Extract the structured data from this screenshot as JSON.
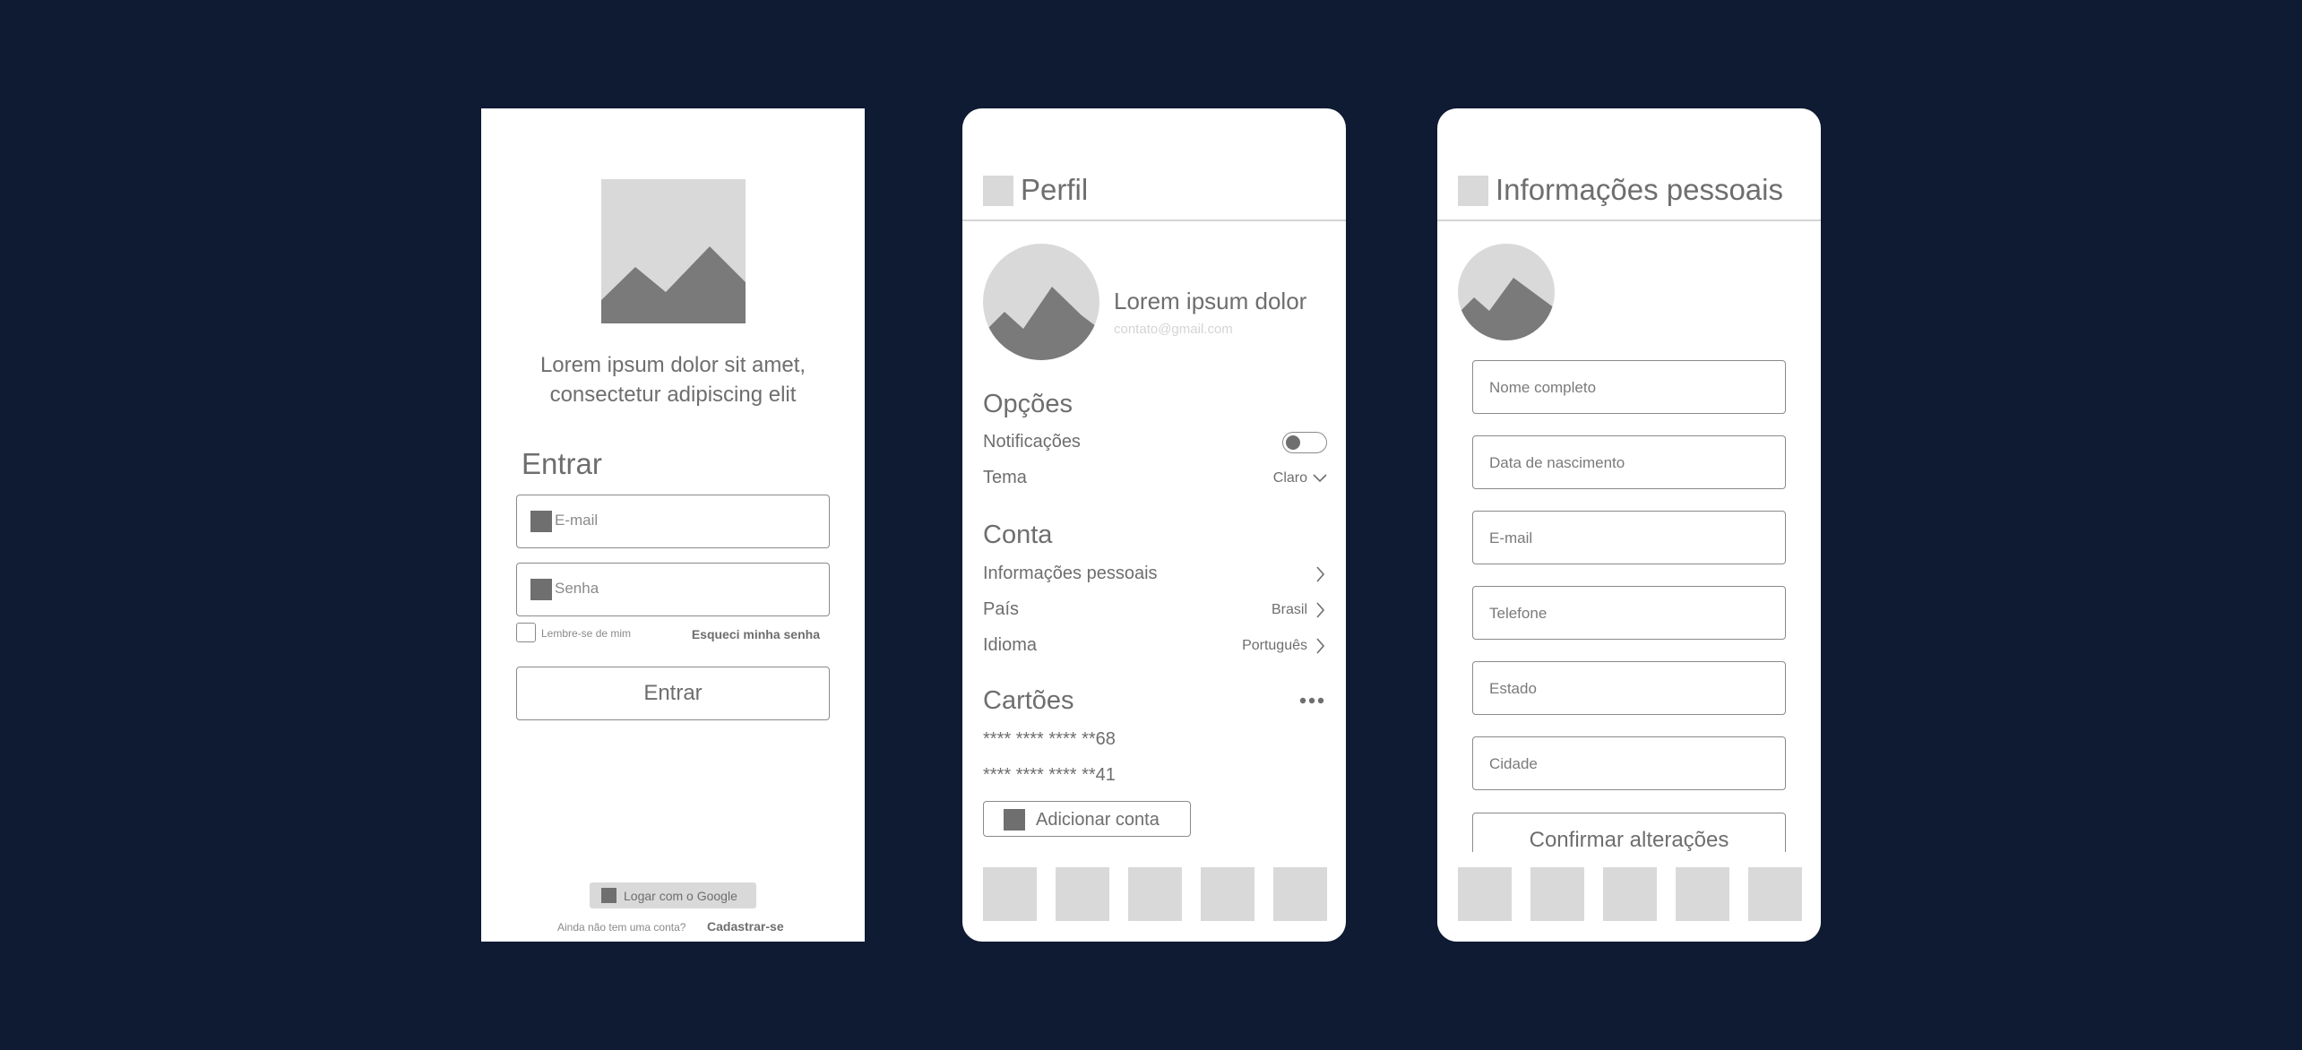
{
  "login": {
    "tagline_line1": "Lorem ipsum dolor sit amet,",
    "tagline_line2": "consectetur adipiscing elit",
    "title": "Entrar",
    "email_placeholder": "E-mail",
    "password_placeholder": "Senha",
    "remember_label": "Lembre-se de mim",
    "forgot_link": "Esqueci minha senha",
    "submit_label": "Entrar",
    "google_label": "Logar com o Google",
    "signup_question": "Ainda não tem uma conta?",
    "signup_link": "Cadastrar-se"
  },
  "perfil": {
    "title": "Perfil",
    "name": "Lorem ipsum dolor",
    "email": "contato@gmail.com",
    "opcoes": {
      "title": "Opções",
      "notifications_label": "Notificações",
      "notifications_enabled": false,
      "theme_label": "Tema",
      "theme_value": "Claro"
    },
    "conta": {
      "title": "Conta",
      "personal_info_label": "Informações pessoais",
      "country_label": "País",
      "country_value": "Brasil",
      "language_label": "Idioma",
      "language_value": "Português"
    },
    "cartoes": {
      "title": "Cartões",
      "cards": [
        "**** **** **** **68",
        "**** **** **** **41"
      ],
      "add_label": "Adicionar conta"
    }
  },
  "info": {
    "title": "Informações pessoais",
    "fields": {
      "full_name": "Nome completo",
      "birth_date": "Data de nascimento",
      "email": "E-mail",
      "phone": "Telefone",
      "state": "Estado",
      "city": "Cidade"
    },
    "confirm_label": "Confirmar alterações"
  },
  "colors": {
    "background": "#0f1a33",
    "screen": "#ffffff",
    "placeholder_fill": "#d9d9d9",
    "icon_fill": "#6f6f6f",
    "text": "#6e6e6e"
  }
}
